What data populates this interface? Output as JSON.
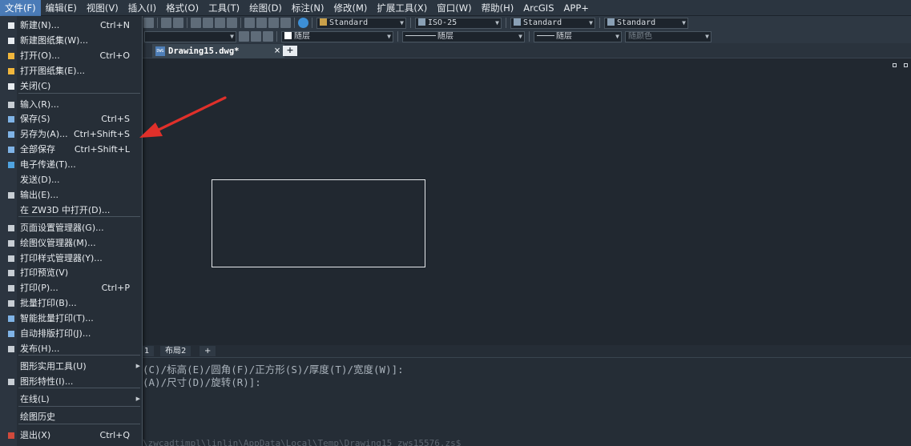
{
  "menubar": [
    "文件(F)",
    "编辑(E)",
    "视图(V)",
    "插入(I)",
    "格式(O)",
    "工具(T)",
    "绘图(D)",
    "标注(N)",
    "修改(M)",
    "扩展工具(X)",
    "窗口(W)",
    "帮助(H)",
    "ArcGIS",
    "APP+"
  ],
  "toolbar": {
    "text_style": "Standard",
    "dim_style": "ISO-25",
    "table_style": "Standard",
    "multileader_style": "Standard",
    "layer_color": "随层",
    "linetype": "随层",
    "lineweight": "随层",
    "plot_style": "随颜色"
  },
  "tabs": {
    "document": "Drawing15.dwg*",
    "dwg_badge": "DWG",
    "close": "×",
    "new_tab": "+"
  },
  "layout_tabs": [
    "1",
    "布局2",
    "+"
  ],
  "command": {
    "line1": "(C)/标高(E)/圆角(F)/正方形(S)/厚度(T)/宽度(W)]:",
    "line2": "(A)/尺寸(D)/旋转(R)]:",
    "line3": "\\zwcadtimpl\\linlin\\AppData\\Local\\Temp\\Drawing15_zws15576.zs$"
  },
  "file_menu": {
    "items": [
      {
        "label": "新建(N)...",
        "shortcut": "Ctrl+N",
        "icon": "new-file-icon",
        "color": "#e8ecf0"
      },
      {
        "label": "新建图纸集(W)...",
        "shortcut": "",
        "icon": "sheet-set-icon",
        "color": "#e8ecf0"
      },
      {
        "label": "打开(O)...",
        "shortcut": "Ctrl+O",
        "icon": "folder-open-icon",
        "color": "#f0b63c"
      },
      {
        "label": "打开图纸集(E)...",
        "shortcut": "",
        "icon": "open-sheet-set-icon",
        "color": "#f0b63c"
      },
      {
        "label": "关闭(C)",
        "shortcut": "",
        "icon": "close-file-icon",
        "color": "#e8ecf0"
      },
      {
        "label": "输入(R)...",
        "shortcut": "",
        "icon": "import-icon",
        "color": "#c8ced4"
      },
      {
        "label": "保存(S)",
        "shortcut": "Ctrl+S",
        "icon": "save-icon",
        "color": "#7fb3e6"
      },
      {
        "label": "另存为(A)...",
        "shortcut": "Ctrl+Shift+S",
        "icon": "save-as-icon",
        "color": "#7fb3e6"
      },
      {
        "label": "全部保存",
        "shortcut": "Ctrl+Shift+L",
        "icon": "save-all-icon",
        "color": "#7fb3e6"
      },
      {
        "label": "电子传递(T)...",
        "shortcut": "",
        "icon": "etransmit-icon",
        "color": "#4fa3e0"
      },
      {
        "label": "发送(D)...",
        "shortcut": "",
        "icon": "",
        "color": ""
      },
      {
        "label": "输出(E)...",
        "shortcut": "",
        "icon": "export-icon",
        "color": "#c8ced4"
      },
      {
        "label": "在 ZW3D 中打开(D)...",
        "shortcut": "",
        "icon": "",
        "color": ""
      },
      {
        "label": "页面设置管理器(G)...",
        "shortcut": "",
        "icon": "page-setup-icon",
        "color": "#c8ced4"
      },
      {
        "label": "绘图仪管理器(M)...",
        "shortcut": "",
        "icon": "plotter-icon",
        "color": "#c8ced4"
      },
      {
        "label": "打印样式管理器(Y)...",
        "shortcut": "",
        "icon": "plot-style-icon",
        "color": "#c8ced4"
      },
      {
        "label": "打印预览(V)",
        "shortcut": "",
        "icon": "print-preview-icon",
        "color": "#c8ced4"
      },
      {
        "label": "打印(P)...",
        "shortcut": "Ctrl+P",
        "icon": "print-icon",
        "color": "#c8ced4"
      },
      {
        "label": "批量打印(B)...",
        "shortcut": "",
        "icon": "batch-print-icon",
        "color": "#c8ced4"
      },
      {
        "label": "智能批量打印(T)...",
        "shortcut": "",
        "icon": "smart-batch-print-icon",
        "color": "#7fb3e6"
      },
      {
        "label": "自动排版打印(J)...",
        "shortcut": "",
        "icon": "auto-layout-print-icon",
        "color": "#7fb3e6"
      },
      {
        "label": "发布(H)...",
        "shortcut": "",
        "icon": "publish-icon",
        "color": "#c8ced4"
      },
      {
        "label": "图形实用工具(U)",
        "shortcut": "",
        "icon": "",
        "color": "",
        "submenu": true
      },
      {
        "label": "图形特性(I)...",
        "shortcut": "",
        "icon": "drawing-properties-icon",
        "color": "#c8ced4"
      },
      {
        "label": "在线(L)",
        "shortcut": "",
        "icon": "",
        "color": "",
        "submenu": true
      },
      {
        "label": "绘图历史",
        "shortcut": "",
        "icon": "",
        "color": ""
      },
      {
        "label": "退出(X)",
        "shortcut": "Ctrl+Q",
        "icon": "exit-icon",
        "color": "#d04a3c"
      }
    ]
  },
  "colors": {
    "accent": "#4a7bb7",
    "annotation_arrow": "#e0302a",
    "background": "#212830"
  }
}
